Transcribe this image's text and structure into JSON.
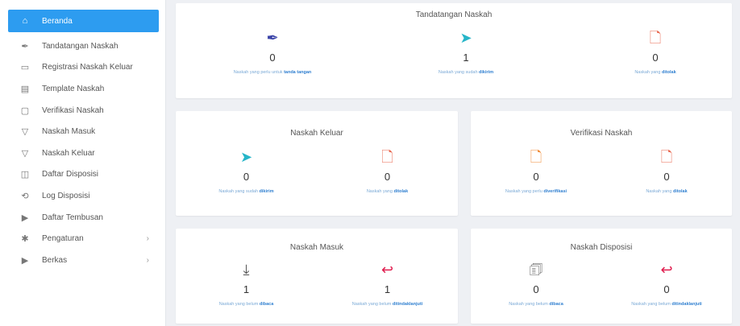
{
  "sidebar": {
    "items": [
      {
        "label": "Beranda",
        "icon": "home-icon",
        "glyph": "⌂",
        "active": true
      },
      {
        "label": "Tandatangan Naskah",
        "icon": "pen-icon",
        "glyph": "✒"
      },
      {
        "label": "Registrasi Naskah Keluar",
        "icon": "document-icon",
        "glyph": "▭"
      },
      {
        "label": "Template Naskah",
        "icon": "template-icon",
        "glyph": "▤"
      },
      {
        "label": "Verifikasi Naskah",
        "icon": "verify-icon",
        "glyph": "▢"
      },
      {
        "label": "Naskah Masuk",
        "icon": "inbox-icon",
        "glyph": "▽"
      },
      {
        "label": "Naskah Keluar",
        "icon": "outbox-icon",
        "glyph": "▽"
      },
      {
        "label": "Daftar Disposisi",
        "icon": "disposition-icon",
        "glyph": "◫"
      },
      {
        "label": "Log Disposisi",
        "icon": "log-icon",
        "glyph": "⟲"
      },
      {
        "label": "Daftar Tembusan",
        "icon": "copy-icon",
        "glyph": "▶"
      },
      {
        "label": "Pengaturan",
        "icon": "gear-icon",
        "glyph": "✱",
        "chevron": "›"
      },
      {
        "label": "Berkas",
        "icon": "folder-icon",
        "glyph": "▶",
        "chevron": "›"
      }
    ]
  },
  "cards": {
    "tandatangan": {
      "title": "Tandatangan Naskah",
      "stats": [
        {
          "icon": "feather-pen-icon",
          "glyph": "✒",
          "color": "#3a43a8",
          "value": "0",
          "caption": "Naskah yang perlu untuk ",
          "caption_bold": "tanda tangan"
        },
        {
          "icon": "paper-plane-icon",
          "glyph": "➤",
          "color": "#26b5c8",
          "value": "1",
          "caption": "Naskah yang sudah ",
          "caption_bold": "dikirim"
        },
        {
          "icon": "file-minus-icon",
          "glyph": "🗋",
          "color": "#e8674f",
          "value": "0",
          "caption": "Naskah yang ",
          "caption_bold": "ditolak"
        }
      ]
    },
    "keluar": {
      "title": "Naskah Keluar",
      "stats": [
        {
          "icon": "paper-plane-icon",
          "glyph": "➤",
          "color": "#26b5c8",
          "value": "0",
          "caption": "Naskah yang sudah ",
          "caption_bold": "dikirim"
        },
        {
          "icon": "file-minus-icon",
          "glyph": "🗋",
          "color": "#e8674f",
          "value": "0",
          "caption": "Naskah yang ",
          "caption_bold": "ditolak"
        }
      ]
    },
    "verifikasi": {
      "title": "Verifikasi Naskah",
      "stats": [
        {
          "icon": "file-edit-icon",
          "glyph": "🗋",
          "color": "#f08a36",
          "value": "0",
          "caption": "Naskah yang perlu ",
          "caption_bold": "diverifikasi"
        },
        {
          "icon": "file-minus-icon",
          "glyph": "🗋",
          "color": "#e8674f",
          "value": "0",
          "caption": "Naskah yang ",
          "caption_bold": "ditolak"
        }
      ]
    },
    "masuk": {
      "title": "Naskah Masuk",
      "stats": [
        {
          "icon": "file-download-icon",
          "glyph": "⤓",
          "color": "#555555",
          "value": "1",
          "caption": "Naskah yang belum ",
          "caption_bold": "dibaca"
        },
        {
          "icon": "reply-arrow-icon",
          "glyph": "↩",
          "color": "#e01e4f",
          "value": "1",
          "caption": "Naskah yang belum ",
          "caption_bold": "ditindaklanjuti"
        }
      ]
    },
    "disposisi": {
      "title": "Naskah Disposisi",
      "stats": [
        {
          "icon": "sticky-note-icon",
          "glyph": "🗊",
          "color": "#555555",
          "value": "0",
          "caption": "Naskah yang belum ",
          "caption_bold": "dibaca"
        },
        {
          "icon": "reply-arrow-icon",
          "glyph": "↩",
          "color": "#e01e4f",
          "value": "0",
          "caption": "Naskah yang belum ",
          "caption_bold": "ditindaklanjuti"
        }
      ]
    }
  }
}
